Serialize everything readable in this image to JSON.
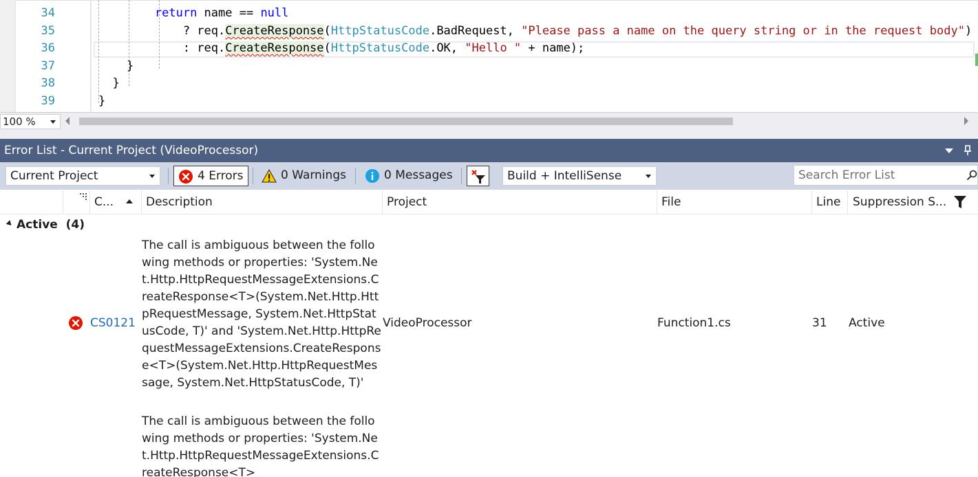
{
  "editor": {
    "lines": [
      {
        "num": "34",
        "segments": [
          {
            "t": "        ",
            "c": ""
          },
          {
            "t": "return",
            "c": "kw"
          },
          {
            "t": " name == ",
            "c": ""
          },
          {
            "t": "null",
            "c": "kw"
          }
        ]
      },
      {
        "num": "35",
        "segments": [
          {
            "t": "            ? req.",
            "c": ""
          },
          {
            "t": "CreateResponse",
            "c": "squig"
          },
          {
            "t": "(",
            "c": ""
          },
          {
            "t": "HttpStatusCode",
            "c": "ty"
          },
          {
            "t": ".BadRequest, ",
            "c": ""
          },
          {
            "t": "\"Please pass a name on the query string or in the request body\"",
            "c": "st"
          },
          {
            "t": ")",
            "c": ""
          }
        ]
      },
      {
        "num": "36",
        "segments": [
          {
            "t": "            : req.",
            "c": ""
          },
          {
            "t": "CreateResponse",
            "c": "squig"
          },
          {
            "t": "(",
            "c": ""
          },
          {
            "t": "HttpStatusCode",
            "c": "ty"
          },
          {
            "t": ".OK, ",
            "c": ""
          },
          {
            "t": "\"Hello \"",
            "c": "st"
          },
          {
            "t": " + name);",
            "c": ""
          }
        ]
      },
      {
        "num": "37",
        "segments": [
          {
            "t": "    }",
            "c": ""
          }
        ]
      },
      {
        "num": "38",
        "segments": [
          {
            "t": "  }",
            "c": ""
          }
        ]
      },
      {
        "num": "39",
        "segments": [
          {
            "t": "}",
            "c": ""
          }
        ]
      }
    ],
    "zoom": "100 %"
  },
  "error_list": {
    "title": "Error List - Current Project (VideoProcessor)",
    "scope_filter": "Current Project",
    "errors_label": "4 Errors",
    "warnings_label": "0 Warnings",
    "messages_label": "0 Messages",
    "build_filter": "Build + IntelliSense",
    "search_placeholder": "Search Error List",
    "columns": {
      "code": "C...",
      "description": "Description",
      "project": "Project",
      "file": "File",
      "line": "Line",
      "suppression": "Suppression S..."
    },
    "group": {
      "label": "Active",
      "count": "(4)"
    },
    "rows": [
      {
        "code": "CS0121",
        "description": "The call is ambiguous between the following methods or properties: 'System.Net.Http.HttpRequestMessageExtensions.CreateResponse<T>(System.Net.Http.HttpRequestMessage, System.Net.HttpStatusCode, T)' and 'System.Net.Http.HttpRequestMessageExtensions.CreateResponse<T>(System.Net.Http.HttpRequestMessage, System.Net.HttpStatusCode, T)'",
        "project": "VideoProcessor",
        "file": "Function1.cs",
        "line": "31",
        "suppression": "Active"
      },
      {
        "code": "",
        "description": "The call is ambiguous between the following methods or properties: 'System.Net.Http.HttpRequestMessageExtensions.CreateResponse<T>",
        "project": "",
        "file": "",
        "line": "",
        "suppression": ""
      }
    ]
  },
  "colors": {
    "title_bar": "#4d6082",
    "toolbar": "#cfd6e5",
    "error_red": "#e51400",
    "info_blue": "#1ba1e2",
    "warning_yellow": "#ffcc00",
    "link": "#1e69c2"
  }
}
